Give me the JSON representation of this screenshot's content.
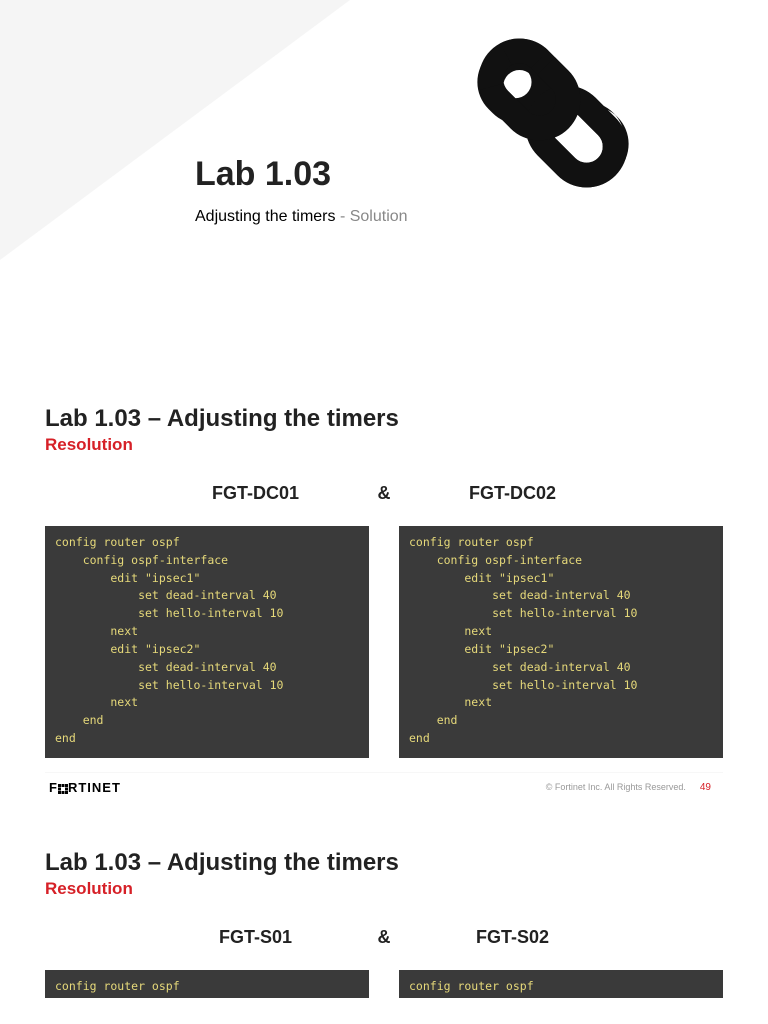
{
  "title_slide": {
    "heading": "Lab 1.03",
    "subtitle_black": "Adjusting the timers",
    "subtitle_gray": " - Solution"
  },
  "slide2": {
    "heading": "Lab 1.03 – Adjusting the timers",
    "label": "Resolution",
    "host_left": "FGT-DC01",
    "amp": "&",
    "host_right": "FGT-DC02",
    "code_left": "config router ospf\n    config ospf-interface\n        edit \"ipsec1\"\n            set dead-interval 40\n            set hello-interval 10\n        next\n        edit \"ipsec2\"\n            set dead-interval 40\n            set hello-interval 10\n        next\n    end\nend",
    "code_right": "config router ospf\n    config ospf-interface\n        edit \"ipsec1\"\n            set dead-interval 40\n            set hello-interval 10\n        next\n        edit \"ipsec2\"\n            set dead-interval 40\n            set hello-interval 10\n        next\n    end\nend",
    "footer_logo": "F  RTINET",
    "footer_copy": "© Fortinet Inc. All Rights Reserved.",
    "footer_page": "49"
  },
  "slide3": {
    "heading": "Lab 1.03 – Adjusting the timers",
    "label": "Resolution",
    "host_left": "FGT-S01",
    "amp": "&",
    "host_right": "FGT-S02",
    "code_left": "config router ospf",
    "code_right": "config router ospf"
  }
}
